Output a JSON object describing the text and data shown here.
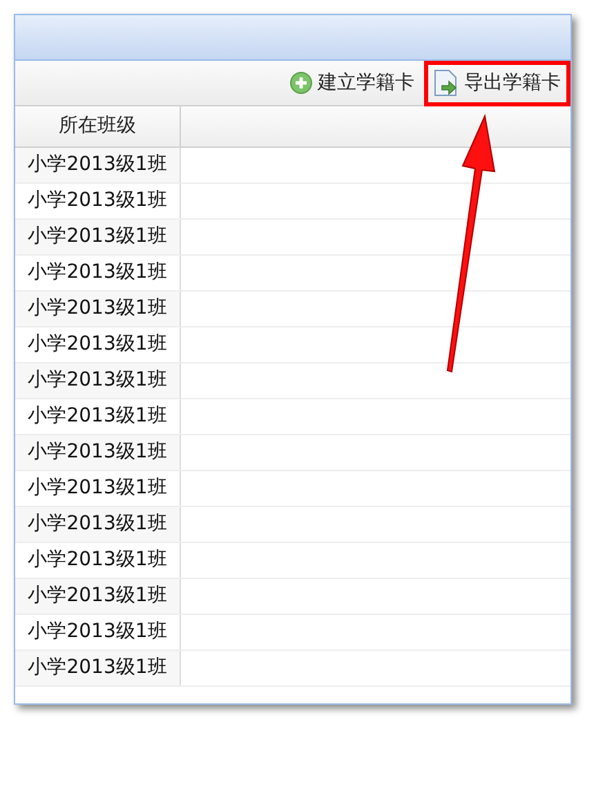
{
  "toolbar": {
    "buttons": [
      {
        "label": "建立学籍卡",
        "kind": "add",
        "highlighted": false
      },
      {
        "label": "导出学籍卡",
        "kind": "export",
        "highlighted": true
      }
    ]
  },
  "table": {
    "columns": [
      "所在班级"
    ],
    "rows": [
      [
        "小学2013级1班"
      ],
      [
        "小学2013级1班"
      ],
      [
        "小学2013级1班"
      ],
      [
        "小学2013级1班"
      ],
      [
        "小学2013级1班"
      ],
      [
        "小学2013级1班"
      ],
      [
        "小学2013级1班"
      ],
      [
        "小学2013级1班"
      ],
      [
        "小学2013级1班"
      ],
      [
        "小学2013级1班"
      ],
      [
        "小学2013级1班"
      ],
      [
        "小学2013级1班"
      ],
      [
        "小学2013级1班"
      ],
      [
        "小学2013级1班"
      ],
      [
        "小学2013级1班"
      ]
    ]
  }
}
